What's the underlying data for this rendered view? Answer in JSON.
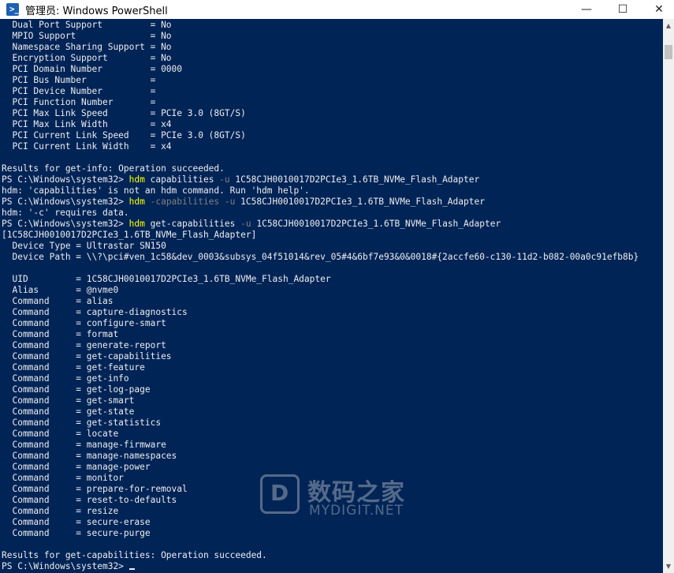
{
  "window": {
    "title": "管理员: Windows PowerShell",
    "icon": "powershell-icon",
    "controls": {
      "minimize": "—",
      "maximize": "☐",
      "close": "✕"
    }
  },
  "colors": {
    "background": "#012456",
    "text": "#eeedf0",
    "command": "#ffff00",
    "parameter": "#808080"
  },
  "terminal": {
    "lines": [
      "  Dual Port Support         = No",
      "  MPIO Support              = No",
      "  Namespace Sharing Support = No",
      "  Encryption Support        = No",
      "  PCI Domain Number         = 0000",
      "  PCI Bus Number            =",
      "  PCI Device Number         =",
      "  PCI Function Number       =",
      "  PCI Max Link Speed        = PCIe 3.0 (8GT/S)",
      "  PCI Max Link Width        = x4",
      "  PCI Current Link Speed    = PCIe 3.0 (8GT/S)",
      "  PCI Current Link Width    = x4",
      "",
      "Results for get-info: Operation succeeded.",
      {
        "prompt": "PS C:\\Windows\\system32> ",
        "cmd": "hdm",
        "rest": [
          {
            "t": " capabilities ",
            "k": "arg"
          },
          {
            "t": "-u",
            "k": "param"
          },
          {
            "t": " 1C58CJH0010017D2PCIe3_1.6TB_NVMe_Flash_Adapter",
            "k": "arg"
          }
        ]
      },
      "hdm: 'capabilities' is not an hdm command. Run 'hdm help'.",
      {
        "prompt": "PS C:\\Windows\\system32> ",
        "cmd": "hdm",
        "rest": [
          {
            "t": " -capabilities -u",
            "k": "param"
          },
          {
            "t": " 1C58CJH0010017D2PCIe3_1.6TB_NVMe_Flash_Adapter",
            "k": "arg"
          }
        ]
      },
      "hdm: '-c' requires data.",
      {
        "prompt": "PS C:\\Windows\\system32> ",
        "cmd": "hdm",
        "rest": [
          {
            "t": " get-capabilities ",
            "k": "arg"
          },
          {
            "t": "-u",
            "k": "param"
          },
          {
            "t": " 1C58CJH0010017D2PCIe3_1.6TB_NVMe_Flash_Adapter",
            "k": "arg"
          }
        ]
      },
      "[1C58CJH0010017D2PCIe3_1.6TB_NVMe_Flash_Adapter]",
      "  Device Type = Ultrastar SN150",
      "  Device Path = \\\\?\\pci#ven_1c58&dev_0003&subsys_04f51014&rev_05#4&6bf7e93&0&0018#{2accfe60-c130-11d2-b082-00a0c91efb8b}",
      "",
      "  UID         = 1C58CJH0010017D2PCIe3_1.6TB_NVMe_Flash_Adapter",
      "  Alias       = @nvme0",
      "  Command     = alias",
      "  Command     = capture-diagnostics",
      "  Command     = configure-smart",
      "  Command     = format",
      "  Command     = generate-report",
      "  Command     = get-capabilities",
      "  Command     = get-feature",
      "  Command     = get-info",
      "  Command     = get-log-page",
      "  Command     = get-smart",
      "  Command     = get-state",
      "  Command     = get-statistics",
      "  Command     = locate",
      "  Command     = manage-firmware",
      "  Command     = manage-namespaces",
      "  Command     = manage-power",
      "  Command     = monitor",
      "  Command     = prepare-for-removal",
      "  Command     = reset-to-defaults",
      "  Command     = resize",
      "  Command     = secure-erase",
      "  Command     = secure-purge",
      "",
      "Results for get-capabilities: Operation succeeded.",
      {
        "prompt": "PS C:\\Windows\\system32> ",
        "cursor": true
      }
    ]
  },
  "watermark": {
    "text_cn": "数码之家",
    "text_en": "MYDIGIT.NET"
  }
}
